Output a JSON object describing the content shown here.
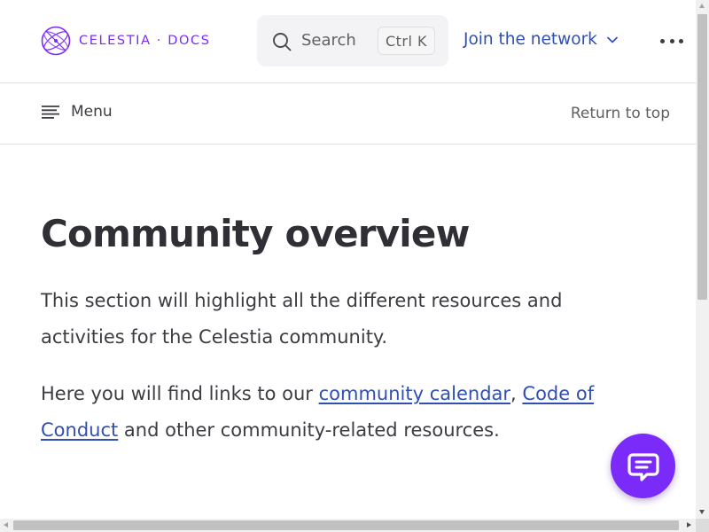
{
  "brand": {
    "logo_text": "CELESTIA · DOCS",
    "accent_color": "#7b2bf9",
    "link_color": "#2f4fb3"
  },
  "header": {
    "search": {
      "label": "Search",
      "shortcut": "Ctrl K",
      "icon": "search-icon"
    },
    "nav": {
      "join_label": "Join the network",
      "join_icon": "chevron-down-icon"
    },
    "more_icon": "more-horizontal-icon"
  },
  "subnav": {
    "menu_label": "Menu",
    "menu_icon": "menu-lines-icon",
    "return_to_top": "Return to top"
  },
  "content": {
    "title": "Community overview",
    "paragraph1": "This section will highlight all the different resources and activities for the Celestia community.",
    "paragraph2": {
      "prefix": "Here you will find links to our ",
      "link1": "community calendar",
      "separator": ", ",
      "link2": "Code of Conduct",
      "suffix": " and other community-related resources."
    }
  },
  "chat": {
    "icon": "chat-bubble-icon"
  }
}
